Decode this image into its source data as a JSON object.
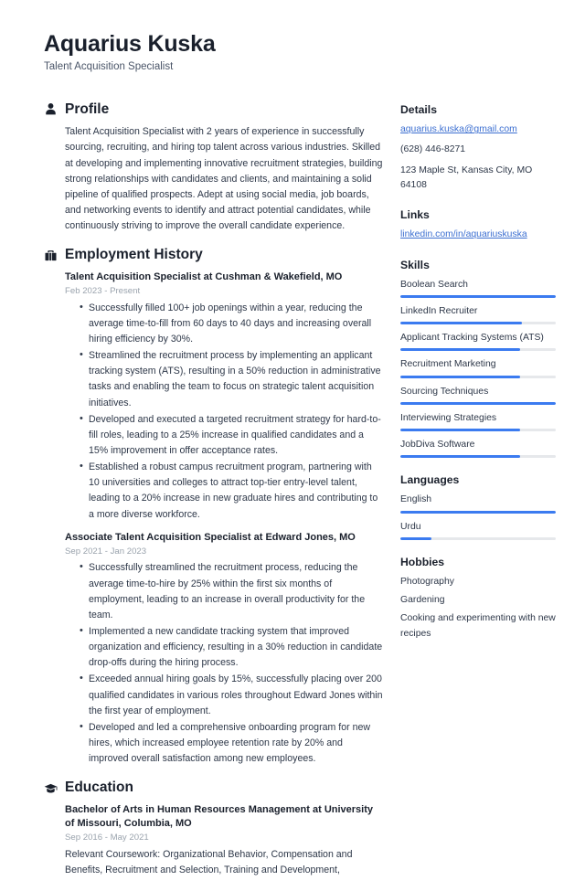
{
  "header": {
    "name": "Aquarius Kuska",
    "title": "Talent Acquisition Specialist"
  },
  "accent_color": "#3b7bf0",
  "link_color": "#3c6fd1",
  "sections": {
    "profile": {
      "icon": "person-icon",
      "title": "Profile",
      "text": "Talent Acquisition Specialist with 2 years of experience in successfully sourcing, recruiting, and hiring top talent across various industries. Skilled at developing and implementing innovative recruitment strategies, building strong relationships with candidates and clients, and maintaining a solid pipeline of qualified prospects. Adept at using social media, job boards, and networking events to identify and attract potential candidates, while continuously striving to improve the overall candidate experience."
    },
    "employment": {
      "icon": "briefcase-icon",
      "title": "Employment History",
      "entries": [
        {
          "title": "Talent Acquisition Specialist at Cushman & Wakefield, MO",
          "date": "Feb 2023 - Present",
          "bullets": [
            "Successfully filled 100+ job openings within a year, reducing the average time-to-fill from 60 days to 40 days and increasing overall hiring efficiency by 30%.",
            "Streamlined the recruitment process by implementing an applicant tracking system (ATS), resulting in a 50% reduction in administrative tasks and enabling the team to focus on strategic talent acquisition initiatives.",
            "Developed and executed a targeted recruitment strategy for hard-to-fill roles, leading to a 25% increase in qualified candidates and a 15% improvement in offer acceptance rates.",
            "Established a robust campus recruitment program, partnering with 10 universities and colleges to attract top-tier entry-level talent, leading to a 20% increase in new graduate hires and contributing to a more diverse workforce."
          ]
        },
        {
          "title": "Associate Talent Acquisition Specialist at Edward Jones, MO",
          "date": "Sep 2021 - Jan 2023",
          "bullets": [
            "Successfully streamlined the recruitment process, reducing the average time-to-hire by 25% within the first six months of employment, leading to an increase in overall productivity for the team.",
            "Implemented a new candidate tracking system that improved organization and efficiency, resulting in a 30% reduction in candidate drop-offs during the hiring process.",
            "Exceeded annual hiring goals by 15%, successfully placing over 200 qualified candidates in various roles throughout Edward Jones within the first year of employment.",
            "Developed and led a comprehensive onboarding program for new hires, which increased employee retention rate by 20% and improved overall satisfaction among new employees."
          ]
        }
      ]
    },
    "education": {
      "icon": "graduation-cap-icon",
      "title": "Education",
      "entries": [
        {
          "title": "Bachelor of Arts in Human Resources Management at University of Missouri, Columbia, MO",
          "date": "Sep 2016 - May 2021",
          "description": "Relevant Coursework: Organizational Behavior, Compensation and Benefits, Recruitment and Selection, Training and Development,"
        }
      ]
    }
  },
  "sidebar": {
    "details": {
      "title": "Details",
      "email": "aquarius.kuska@gmail.com",
      "phone": "(628) 446-8271",
      "address": "123 Maple St, Kansas City, MO 64108"
    },
    "links": {
      "title": "Links",
      "items": [
        {
          "label": "linkedin.com/in/aquariuskuska"
        }
      ]
    },
    "skills": {
      "title": "Skills",
      "items": [
        {
          "label": "Boolean Search",
          "level": 100
        },
        {
          "label": "LinkedIn Recruiter",
          "level": 78
        },
        {
          "label": "Applicant Tracking Systems (ATS)",
          "level": 77
        },
        {
          "label": "Recruitment Marketing",
          "level": 77
        },
        {
          "label": "Sourcing Techniques",
          "level": 100
        },
        {
          "label": "Interviewing Strategies",
          "level": 77
        },
        {
          "label": "JobDiva Software",
          "level": 77
        }
      ]
    },
    "languages": {
      "title": "Languages",
      "items": [
        {
          "label": "English",
          "level": 100
        },
        {
          "label": "Urdu",
          "level": 20
        }
      ]
    },
    "hobbies": {
      "title": "Hobbies",
      "items": [
        {
          "label": "Photography"
        },
        {
          "label": "Gardening"
        },
        {
          "label": "Cooking and experimenting with new recipes"
        }
      ]
    }
  }
}
